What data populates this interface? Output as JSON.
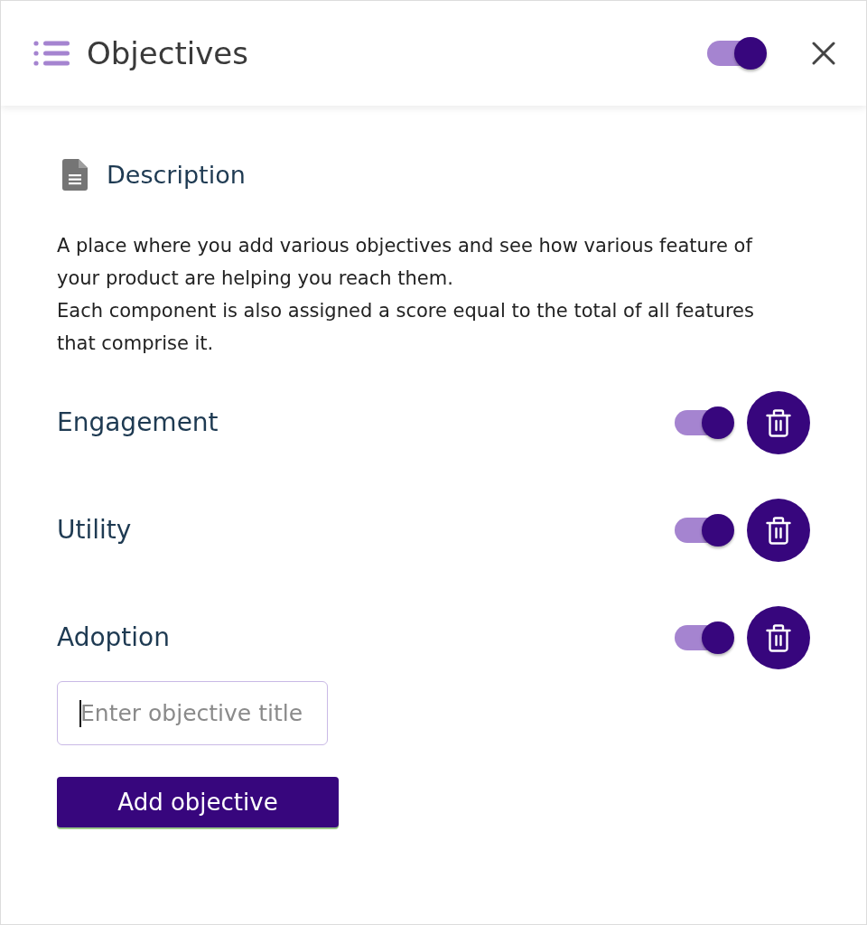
{
  "header": {
    "title": "Objectives",
    "toggle": {
      "on": true
    }
  },
  "description": {
    "heading": "Description",
    "paragraphs": [
      "A place where you add various objectives and see how various feature of your product are helping you reach them.",
      "Each component is also assigned a score equal to the total of all features that comprise it."
    ]
  },
  "objectives": [
    {
      "title": "Engagement",
      "on": true
    },
    {
      "title": "Utility",
      "on": true
    },
    {
      "title": "Adoption",
      "on": true
    }
  ],
  "new_objective": {
    "placeholder": "Enter objective title",
    "focused": true
  },
  "add_button": "Add objective"
}
